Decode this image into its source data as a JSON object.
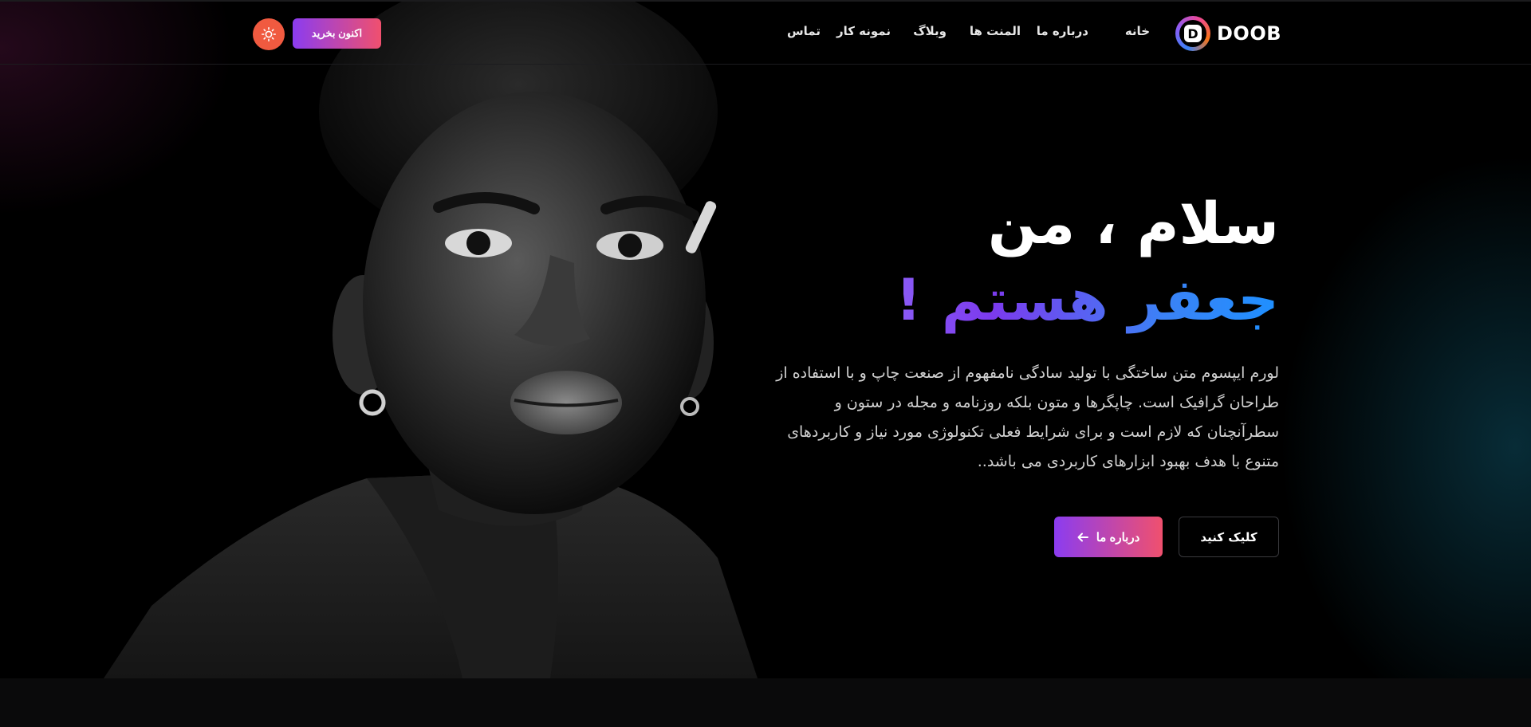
{
  "brand": {
    "logo_letter": "D",
    "name": "DOOB"
  },
  "nav": {
    "items": [
      {
        "label": "خانه"
      },
      {
        "label": "درباره ما"
      },
      {
        "label": "المنت ها"
      },
      {
        "label": "وبلاگ"
      },
      {
        "label": "نمونه کار"
      },
      {
        "label": "تماس"
      }
    ]
  },
  "header": {
    "buy_label": "اکنون بخرید",
    "theme_icon": "sun-icon"
  },
  "hero": {
    "title_line1": "سلام ، من",
    "title_line2": "جعفر هستم !",
    "lead": "لورم ایپسوم متن ساختگی با تولید سادگی نامفهوم از صنعت چاپ و با استفاده از طراحان گرافیک است. چاپگرها و متون بلکه روزنامه و مجله در ستون و سطرآنچنان که لازم است و برای شرایط فعلی تکنولوژی مورد نیاز و کاربردهای متنوع با هدف بهبود ابزارهای کاربردی می باشد..",
    "about_button": "درباره ما",
    "click_button": "کلیک کنید"
  },
  "colors": {
    "accent_start": "#8b3cf0",
    "accent_end": "#f0506e",
    "title_gradient_start": "#1e90ff",
    "title_gradient_end": "#8b5cf6",
    "theme_button": "#f05a40"
  }
}
